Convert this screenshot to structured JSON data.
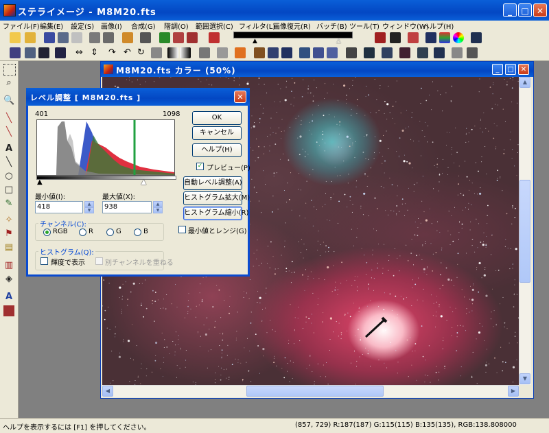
{
  "app": {
    "title": "ステライメージ - M8M20.fts"
  },
  "menu": [
    "ファイル(F)",
    "編集(E)",
    "設定(S)",
    "画像(I)",
    "合成(G)",
    "階調(O)",
    "範囲選択(C)",
    "フィルタ(L)",
    "画像復元(R)",
    "バッチ(B)",
    "ツール(T)",
    "ウィンドウ(W)",
    "ヘルプ(H)"
  ],
  "image_window": {
    "title": "M8M20.fts カラー (50%)"
  },
  "dialog": {
    "title": "レベル調整 [ M8M20.fts ]",
    "hist_left": "401",
    "hist_right": "1098",
    "min_label": "最小値(I):",
    "min_value": "418",
    "max_label": "最大値(X):",
    "max_value": "938",
    "min_level": 0.03,
    "max_level": 0.78,
    "buttons": {
      "ok": "OK",
      "cancel": "キャンセル",
      "help": "ヘルプ(H)",
      "auto_level": "自動レベル調整(A)",
      "hist_expand": "ヒストグラム拡大(M)",
      "hist_shrink": "ヒストグラム縮小(R)"
    },
    "preview_label": "プレビュー(P)",
    "preview_checked": true,
    "minmax_range_label": "最小値とレンジ(G)",
    "minmax_range_checked": false,
    "channel": {
      "title": "チャンネル(C):",
      "options": [
        "RGB",
        "R",
        "G",
        "B"
      ],
      "selected": "RGB"
    },
    "histogram": {
      "title": "ヒストグラム(Q):",
      "luminance_label": "輝度で表示",
      "luminance_checked": false,
      "overlay_label": "別チャンネルを重ねる",
      "overlay_checked": false
    }
  },
  "status": {
    "help": "ヘルプを表示するには [F1] を押してください。",
    "pixel": "(857, 729) R:187(187) G:115(115) B:135(135), RGB:138.808000"
  },
  "colors": {
    "title_blue": "#0347c3",
    "dialog_bg": "#ece9d8"
  }
}
